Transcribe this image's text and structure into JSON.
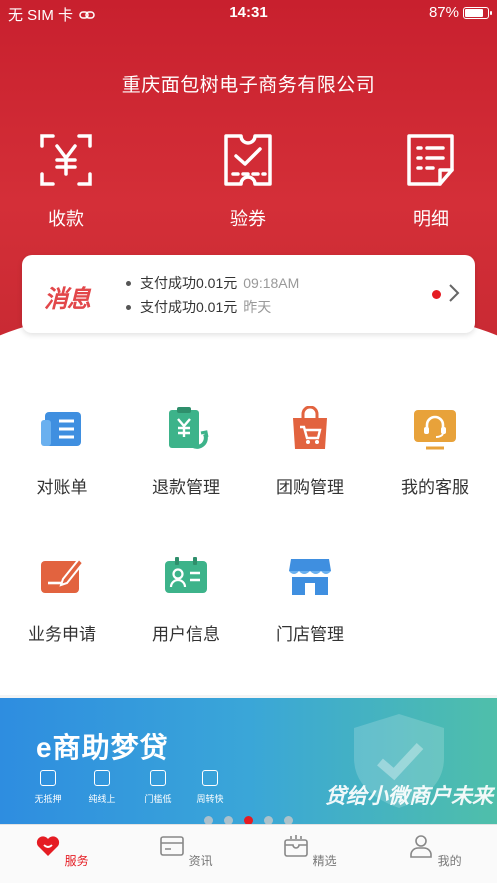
{
  "status_bar": {
    "carrier": "无 SIM 卡",
    "time": "14:31",
    "battery": "87%",
    "battery_level": 0.87
  },
  "company_name": "重庆面包树电子商务有限公司",
  "quick_actions": [
    {
      "label": "收款",
      "icon": "yuan-scan-icon"
    },
    {
      "label": "验券",
      "icon": "ticket-check-icon"
    },
    {
      "label": "明细",
      "icon": "document-list-icon"
    }
  ],
  "messages": {
    "logo": "消息",
    "items": [
      {
        "text": "支付成功0.01元",
        "time": "09:18AM"
      },
      {
        "text": "支付成功0.01元",
        "time": "昨天"
      }
    ]
  },
  "grid": [
    {
      "label": "对账单",
      "icon": "statement-icon",
      "color": "#3f8fe0"
    },
    {
      "label": "退款管理",
      "icon": "refund-icon",
      "color": "#3db38a"
    },
    {
      "label": "团购管理",
      "icon": "shopping-bag-icon",
      "color": "#e2633f"
    },
    {
      "label": "我的客服",
      "icon": "customer-service-icon",
      "color": "#e8a23a"
    },
    {
      "label": "业务申请",
      "icon": "apply-edit-icon",
      "color": "#e2633f"
    },
    {
      "label": "用户信息",
      "icon": "user-card-icon",
      "color": "#3db38a"
    },
    {
      "label": "门店管理",
      "icon": "store-icon",
      "color": "#3f8fe0"
    }
  ],
  "banner": {
    "title": "e商助梦贷",
    "slogan": "贷给小微商户未来",
    "features": [
      "无抵押",
      "纯线上",
      "门槛低",
      "周转快"
    ],
    "slide_count": 5,
    "active_slide": 2
  },
  "tabs": [
    {
      "label": "服务",
      "icon": "heart-service-icon",
      "active": true
    },
    {
      "label": "资讯",
      "icon": "news-card-icon",
      "active": false
    },
    {
      "label": "精选",
      "icon": "selection-box-icon",
      "active": false
    },
    {
      "label": "我的",
      "icon": "person-icon",
      "active": false
    }
  ],
  "colors": {
    "brand_red": "#d42f38",
    "accent": "#e51c23"
  }
}
